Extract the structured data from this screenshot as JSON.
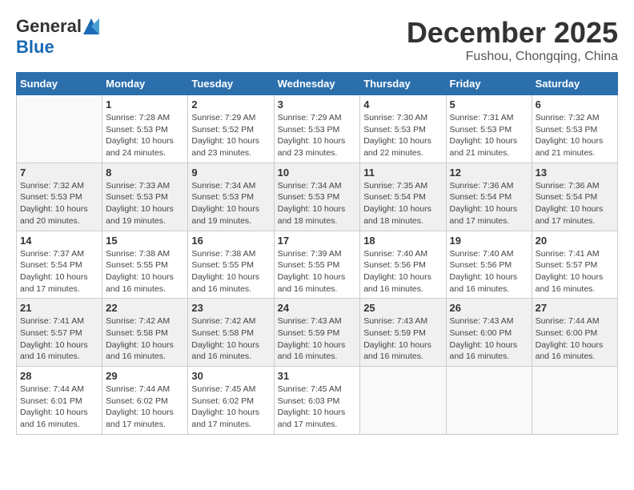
{
  "logo": {
    "general": "General",
    "blue": "Blue"
  },
  "title": {
    "month_year": "December 2025",
    "location": "Fushou, Chongqing, China"
  },
  "headers": [
    "Sunday",
    "Monday",
    "Tuesday",
    "Wednesday",
    "Thursday",
    "Friday",
    "Saturday"
  ],
  "weeks": [
    [
      {
        "day": "",
        "info": ""
      },
      {
        "day": "1",
        "info": "Sunrise: 7:28 AM\nSunset: 5:53 PM\nDaylight: 10 hours\nand 24 minutes."
      },
      {
        "day": "2",
        "info": "Sunrise: 7:29 AM\nSunset: 5:52 PM\nDaylight: 10 hours\nand 23 minutes."
      },
      {
        "day": "3",
        "info": "Sunrise: 7:29 AM\nSunset: 5:53 PM\nDaylight: 10 hours\nand 23 minutes."
      },
      {
        "day": "4",
        "info": "Sunrise: 7:30 AM\nSunset: 5:53 PM\nDaylight: 10 hours\nand 22 minutes."
      },
      {
        "day": "5",
        "info": "Sunrise: 7:31 AM\nSunset: 5:53 PM\nDaylight: 10 hours\nand 21 minutes."
      },
      {
        "day": "6",
        "info": "Sunrise: 7:32 AM\nSunset: 5:53 PM\nDaylight: 10 hours\nand 21 minutes."
      }
    ],
    [
      {
        "day": "7",
        "info": "Sunrise: 7:32 AM\nSunset: 5:53 PM\nDaylight: 10 hours\nand 20 minutes."
      },
      {
        "day": "8",
        "info": "Sunrise: 7:33 AM\nSunset: 5:53 PM\nDaylight: 10 hours\nand 19 minutes."
      },
      {
        "day": "9",
        "info": "Sunrise: 7:34 AM\nSunset: 5:53 PM\nDaylight: 10 hours\nand 19 minutes."
      },
      {
        "day": "10",
        "info": "Sunrise: 7:34 AM\nSunset: 5:53 PM\nDaylight: 10 hours\nand 18 minutes."
      },
      {
        "day": "11",
        "info": "Sunrise: 7:35 AM\nSunset: 5:54 PM\nDaylight: 10 hours\nand 18 minutes."
      },
      {
        "day": "12",
        "info": "Sunrise: 7:36 AM\nSunset: 5:54 PM\nDaylight: 10 hours\nand 17 minutes."
      },
      {
        "day": "13",
        "info": "Sunrise: 7:36 AM\nSunset: 5:54 PM\nDaylight: 10 hours\nand 17 minutes."
      }
    ],
    [
      {
        "day": "14",
        "info": "Sunrise: 7:37 AM\nSunset: 5:54 PM\nDaylight: 10 hours\nand 17 minutes."
      },
      {
        "day": "15",
        "info": "Sunrise: 7:38 AM\nSunset: 5:55 PM\nDaylight: 10 hours\nand 16 minutes."
      },
      {
        "day": "16",
        "info": "Sunrise: 7:38 AM\nSunset: 5:55 PM\nDaylight: 10 hours\nand 16 minutes."
      },
      {
        "day": "17",
        "info": "Sunrise: 7:39 AM\nSunset: 5:55 PM\nDaylight: 10 hours\nand 16 minutes."
      },
      {
        "day": "18",
        "info": "Sunrise: 7:40 AM\nSunset: 5:56 PM\nDaylight: 10 hours\nand 16 minutes."
      },
      {
        "day": "19",
        "info": "Sunrise: 7:40 AM\nSunset: 5:56 PM\nDaylight: 10 hours\nand 16 minutes."
      },
      {
        "day": "20",
        "info": "Sunrise: 7:41 AM\nSunset: 5:57 PM\nDaylight: 10 hours\nand 16 minutes."
      }
    ],
    [
      {
        "day": "21",
        "info": "Sunrise: 7:41 AM\nSunset: 5:57 PM\nDaylight: 10 hours\nand 16 minutes."
      },
      {
        "day": "22",
        "info": "Sunrise: 7:42 AM\nSunset: 5:58 PM\nDaylight: 10 hours\nand 16 minutes."
      },
      {
        "day": "23",
        "info": "Sunrise: 7:42 AM\nSunset: 5:58 PM\nDaylight: 10 hours\nand 16 minutes."
      },
      {
        "day": "24",
        "info": "Sunrise: 7:43 AM\nSunset: 5:59 PM\nDaylight: 10 hours\nand 16 minutes."
      },
      {
        "day": "25",
        "info": "Sunrise: 7:43 AM\nSunset: 5:59 PM\nDaylight: 10 hours\nand 16 minutes."
      },
      {
        "day": "26",
        "info": "Sunrise: 7:43 AM\nSunset: 6:00 PM\nDaylight: 10 hours\nand 16 minutes."
      },
      {
        "day": "27",
        "info": "Sunrise: 7:44 AM\nSunset: 6:00 PM\nDaylight: 10 hours\nand 16 minutes."
      }
    ],
    [
      {
        "day": "28",
        "info": "Sunrise: 7:44 AM\nSunset: 6:01 PM\nDaylight: 10 hours\nand 16 minutes."
      },
      {
        "day": "29",
        "info": "Sunrise: 7:44 AM\nSunset: 6:02 PM\nDaylight: 10 hours\nand 17 minutes."
      },
      {
        "day": "30",
        "info": "Sunrise: 7:45 AM\nSunset: 6:02 PM\nDaylight: 10 hours\nand 17 minutes."
      },
      {
        "day": "31",
        "info": "Sunrise: 7:45 AM\nSunset: 6:03 PM\nDaylight: 10 hours\nand 17 minutes."
      },
      {
        "day": "",
        "info": ""
      },
      {
        "day": "",
        "info": ""
      },
      {
        "day": "",
        "info": ""
      }
    ]
  ]
}
